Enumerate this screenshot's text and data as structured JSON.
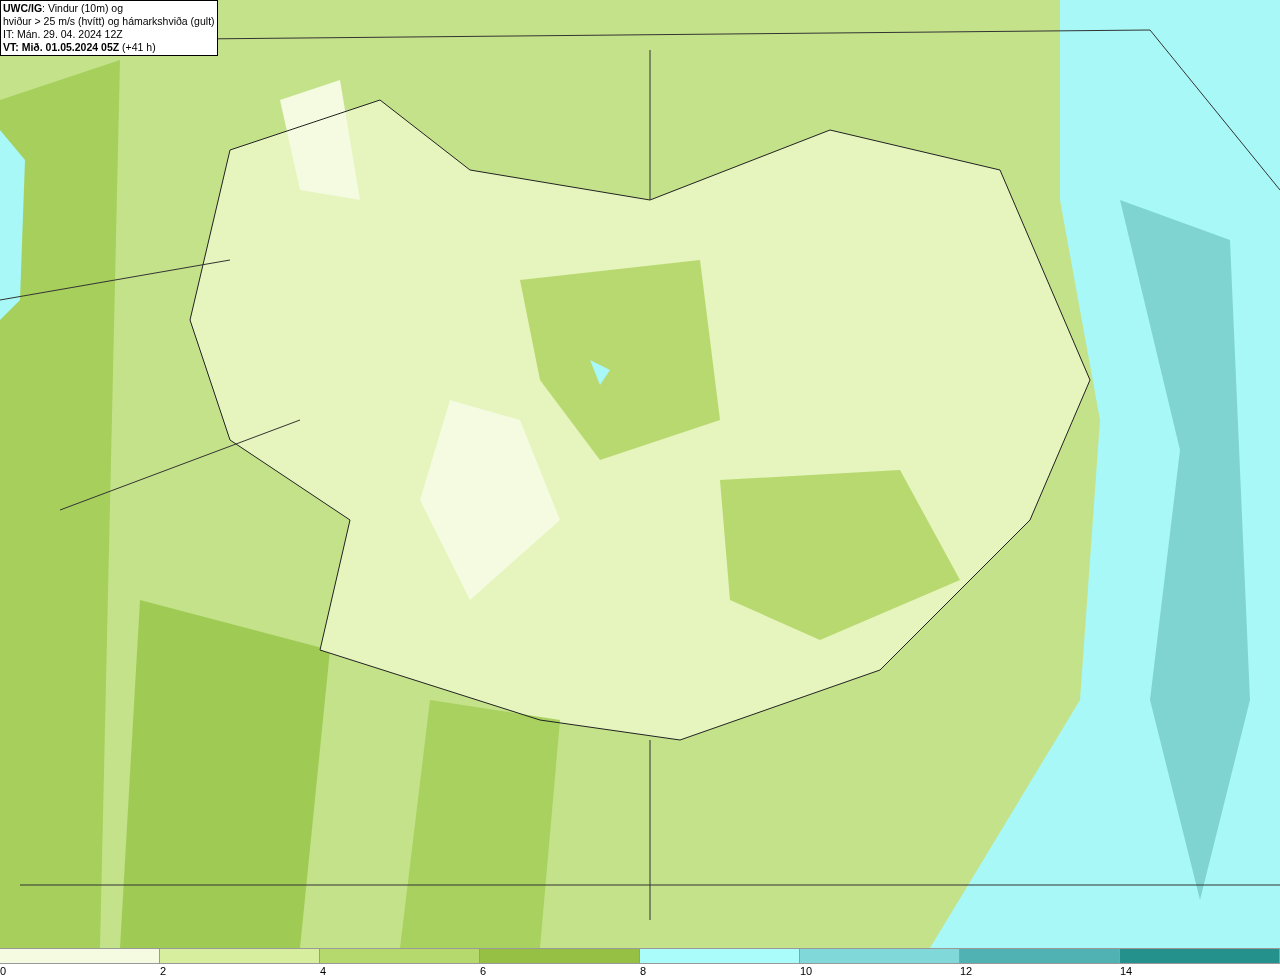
{
  "info_box": {
    "lines": [
      "**UWC/IG**: Vindur (10m) og",
      "hviður > 25 m/s (hvítt) og hámarkshviða (gult)",
      "IT: Mán. 29. 04. 2024 12Z",
      "**VT: Mið. 01.05.2024 05Z** (+41 h)"
    ]
  },
  "legend": [
    {
      "label": "0",
      "color": "#f4fbe0"
    },
    {
      "label": "2",
      "color": "#d8ee9f"
    },
    {
      "label": "4",
      "color": "#b6d96e"
    },
    {
      "label": "6",
      "color": "#95c044"
    },
    {
      "label": "8",
      "color": "#aafcfb"
    },
    {
      "label": "10",
      "color": "#80d8d8"
    },
    {
      "label": "12",
      "color": "#50b2b2"
    },
    {
      "label": "14",
      "color": "#24918d"
    }
  ]
}
